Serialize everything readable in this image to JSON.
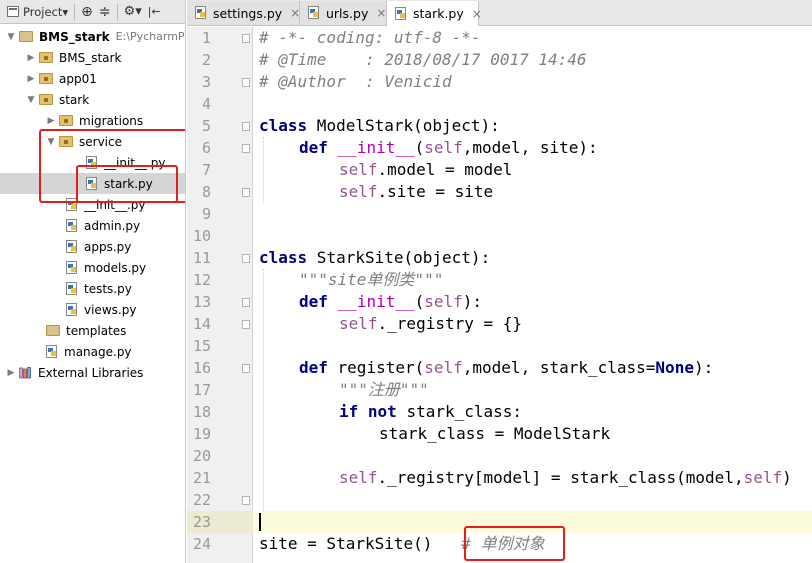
{
  "project_toolbar": {
    "view_label": "Project▾",
    "target_icon": "⊕",
    "collapse_icon": "≑",
    "settings_icon": "⚙▾",
    "hide_icon": "|←"
  },
  "tree": {
    "items": [
      {
        "label": "BMS_stark",
        "path": "E:\\PycharmP"
      },
      {
        "label": "BMS_stark"
      },
      {
        "label": "app01"
      },
      {
        "label": "stark"
      },
      {
        "label": "migrations"
      },
      {
        "label": "service"
      },
      {
        "label": "__init__.py"
      },
      {
        "label": "stark.py"
      },
      {
        "label": "__init__.py"
      },
      {
        "label": "admin.py"
      },
      {
        "label": "apps.py"
      },
      {
        "label": "models.py"
      },
      {
        "label": "tests.py"
      },
      {
        "label": "views.py"
      },
      {
        "label": "templates"
      },
      {
        "label": "manage.py"
      },
      {
        "label": "External Libraries"
      }
    ]
  },
  "tabs": [
    {
      "label": "settings.py",
      "close": "×"
    },
    {
      "label": "urls.py",
      "close": "×"
    },
    {
      "label": "stark.py",
      "close": "×"
    }
  ],
  "editor": {
    "line_numbers": [
      "1",
      "2",
      "3",
      "4",
      "5",
      "6",
      "7",
      "8",
      "9",
      "10",
      "11",
      "12",
      "13",
      "14",
      "15",
      "16",
      "17",
      "18",
      "19",
      "20",
      "21",
      "22",
      "23",
      "24"
    ],
    "code": {
      "l1": "# -*- coding: utf-8 -*-",
      "l2": "# @Time    : 2018/08/17 0017 14:46",
      "l3": "# @Author  : Venicid",
      "l5_kw": "class",
      "l5_rest": " ModelStark(object):",
      "l6_kw": "def",
      "l6_name": "__init__",
      "l6_open": "(",
      "l6_self": "self",
      "l6_rest": ",model, site):",
      "l7_self": "self",
      "l7_rest": ".model = model",
      "l8_self": "self",
      "l8_rest": ".site = site",
      "l11_kw": "class",
      "l11_rest": " StarkSite(object):",
      "l12": "\"\"\"site单例类\"\"\"",
      "l13_kw": "def",
      "l13_name": "__init__",
      "l13_open": "(",
      "l13_self": "self",
      "l13_rest": "):",
      "l14_self": "self",
      "l14_rest": "._registry = {}",
      "l16_kw": "def",
      "l16_name": " register(",
      "l16_self": "self",
      "l16_rest": ",model, stark_class=",
      "l16_none": "None",
      "l16_end": "):",
      "l17": "\"\"\"注册\"\"\"",
      "l18_kw1": "if",
      "l18_kw2": "not",
      "l18_rest": " stark_class:",
      "l19": "stark_class = ModelStark",
      "l21_self": "self",
      "l21_rest": "._registry[model] = stark_class(model,",
      "l21_self2": "self",
      "l21_end": ")",
      "l24_code": "site = StarkSite()",
      "l24_comment": "# 单例对象"
    }
  }
}
